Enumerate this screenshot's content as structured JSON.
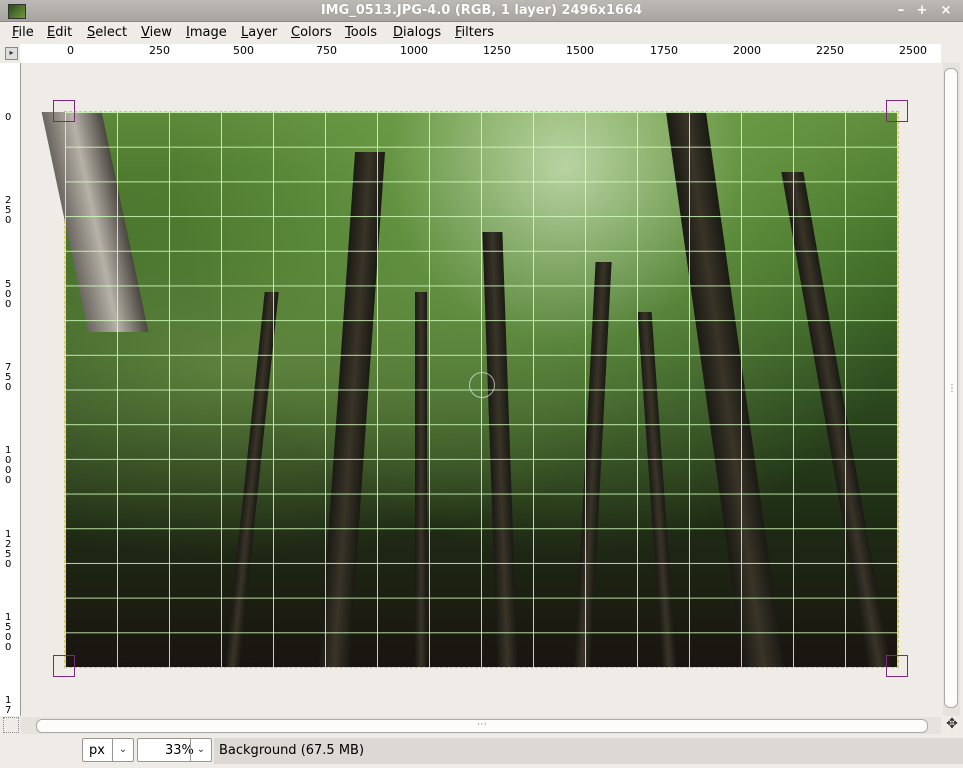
{
  "window": {
    "title": "IMG_0513.JPG-4.0 (RGB, 1 layer) 2496x1664",
    "buttons": [
      "–",
      "+",
      "×"
    ]
  },
  "menu": [
    "File",
    "Edit",
    "Select",
    "View",
    "Image",
    "Layer",
    "Colors",
    "Tools",
    "Dialogs",
    "Filters"
  ],
  "menu_mnemonic": [
    "F",
    "E",
    "S",
    "V",
    "I",
    "L",
    "C",
    "T",
    "D",
    "F"
  ],
  "hruler": [
    "0",
    "250",
    "500",
    "750",
    "1000",
    "1250",
    "1500",
    "1750",
    "2000",
    "2250",
    "2500"
  ],
  "vruler": [
    "0",
    "2\n5\n0",
    "5\n0\n0",
    "7\n5\n0",
    "1\n0\n0\n0",
    "1\n2\n5\n0",
    "1\n5\n0\n0",
    "1\n7"
  ],
  "status": {
    "unit": "px",
    "zoom": "33%",
    "message": "Background (67.5 MB)"
  }
}
